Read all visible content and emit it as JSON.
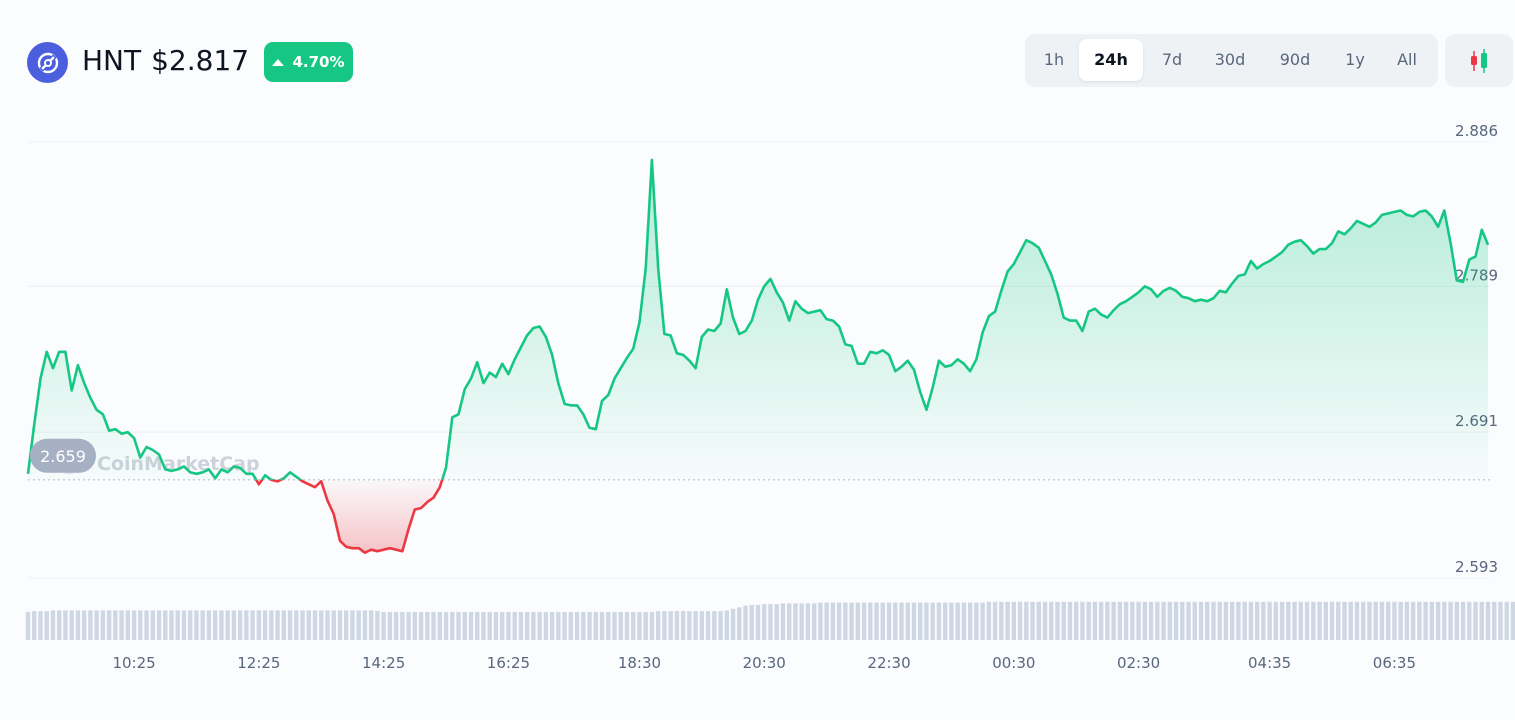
{
  "header": {
    "symbol": "HNT",
    "price": "$2.817",
    "change": "4.70%",
    "change_direction": "up",
    "logo_icon": "helium-logo-icon"
  },
  "ranges": {
    "options": [
      "1h",
      "24h",
      "7d",
      "30d",
      "90d",
      "1y",
      "All"
    ],
    "selected": "24h",
    "candle_icon": "candlestick-icon"
  },
  "watermark": "CoinMarketCap",
  "colors": {
    "up": "#16c784",
    "down": "#ea3943",
    "brand": "#4b5fde"
  },
  "chart_data": {
    "type": "area",
    "title": "",
    "reference_value": 2.659,
    "reference_label": "2.659",
    "y_ticks": [
      2.886,
      2.789,
      2.691,
      2.593
    ],
    "y_tick_labels": [
      "2.886",
      "2.789",
      "2.691",
      "2.593"
    ],
    "ylim": [
      2.593,
      2.886
    ],
    "x_ticks": [
      "10:25",
      "12:25",
      "14:25",
      "16:25",
      "18:30",
      "20:30",
      "22:30",
      "00:30",
      "02:30",
      "04:35",
      "06:35"
    ],
    "x_tick_index": [
      17,
      37,
      57,
      77,
      98,
      118,
      138,
      158,
      178,
      199,
      219
    ],
    "grid": true,
    "series": [
      {
        "values": [
          2.663,
          2.696,
          2.727,
          2.745,
          2.734,
          2.745,
          2.745,
          2.719,
          2.736,
          2.724,
          2.714,
          2.706,
          2.703,
          2.692,
          2.693,
          2.69,
          2.691,
          2.687,
          2.674,
          2.681,
          2.679,
          2.676,
          2.666,
          2.665,
          2.666,
          2.668,
          2.664,
          2.663,
          2.664,
          2.666,
          2.66,
          2.666,
          2.664,
          2.668,
          2.667,
          2.663,
          2.663,
          2.656,
          2.662,
          2.659,
          2.658,
          2.66,
          2.664,
          2.661,
          2.658,
          2.656,
          2.654,
          2.658,
          2.645,
          2.636,
          2.618,
          2.614,
          2.613,
          2.613,
          2.61,
          2.612,
          2.611,
          2.612,
          2.613,
          2.612,
          2.611,
          2.626,
          2.639,
          2.64,
          2.644,
          2.647,
          2.654,
          2.667,
          2.701,
          2.703,
          2.72,
          2.727,
          2.738,
          2.724,
          2.731,
          2.728,
          2.737,
          2.73,
          2.74,
          2.748,
          2.756,
          2.761,
          2.762,
          2.755,
          2.743,
          2.724,
          2.71,
          2.709,
          2.709,
          2.703,
          2.694,
          2.693,
          2.712,
          2.716,
          2.727,
          2.734,
          2.741,
          2.747,
          2.765,
          2.801,
          2.874,
          2.801,
          2.757,
          2.756,
          2.744,
          2.743,
          2.739,
          2.734,
          2.755,
          2.76,
          2.759,
          2.764,
          2.787,
          2.768,
          2.757,
          2.759,
          2.766,
          2.78,
          2.789,
          2.794,
          2.785,
          2.778,
          2.766,
          2.779,
          2.774,
          2.771,
          2.772,
          2.773,
          2.767,
          2.766,
          2.762,
          2.75,
          2.749,
          2.737,
          2.737,
          2.745,
          2.744,
          2.746,
          2.743,
          2.732,
          2.735,
          2.739,
          2.733,
          2.718,
          2.706,
          2.721,
          2.739,
          2.735,
          2.736,
          2.74,
          2.737,
          2.732,
          2.74,
          2.758,
          2.769,
          2.772,
          2.786,
          2.799,
          2.804,
          2.812,
          2.82,
          2.818,
          2.815,
          2.806,
          2.797,
          2.784,
          2.768,
          2.766,
          2.766,
          2.759,
          2.772,
          2.774,
          2.77,
          2.768,
          2.773,
          2.777,
          2.779,
          2.782,
          2.785,
          2.789,
          2.787,
          2.782,
          2.786,
          2.788,
          2.786,
          2.782,
          2.781,
          2.779,
          2.78,
          2.779,
          2.781,
          2.786,
          2.785,
          2.791,
          2.796,
          2.797,
          2.806,
          2.801,
          2.804,
          2.806,
          2.809,
          2.812,
          2.817,
          2.819,
          2.82,
          2.816,
          2.811,
          2.814,
          2.814,
          2.818,
          2.826,
          2.824,
          2.828,
          2.833,
          2.831,
          2.829,
          2.832,
          2.837,
          2.838,
          2.839,
          2.84,
          2.837,
          2.836,
          2.839,
          2.84,
          2.836,
          2.829,
          2.84,
          2.818,
          2.793,
          2.792,
          2.807,
          2.809,
          2.827,
          2.817
        ]
      }
    ],
    "volume_relative": [
      0.36,
      0.37,
      0.37,
      0.37,
      0.38,
      0.38,
      0.38,
      0.38,
      0.38,
      0.38,
      0.38,
      0.38,
      0.38,
      0.38,
      0.38,
      0.38,
      0.38,
      0.38,
      0.38,
      0.38,
      0.38,
      0.38,
      0.38,
      0.38,
      0.38,
      0.38,
      0.38,
      0.38,
      0.38,
      0.38,
      0.38,
      0.38,
      0.38,
      0.38,
      0.38,
      0.38,
      0.38,
      0.38,
      0.38,
      0.38,
      0.38,
      0.38,
      0.38,
      0.38,
      0.38,
      0.38,
      0.38,
      0.38,
      0.38,
      0.38,
      0.38,
      0.38,
      0.38,
      0.38,
      0.38,
      0.38,
      0.37,
      0.36,
      0.36,
      0.36,
      0.36,
      0.36,
      0.36,
      0.36,
      0.36,
      0.36,
      0.36,
      0.36,
      0.36,
      0.36,
      0.36,
      0.36,
      0.36,
      0.36,
      0.36,
      0.36,
      0.36,
      0.36,
      0.36,
      0.36,
      0.36,
      0.36,
      0.36,
      0.36,
      0.36,
      0.36,
      0.36,
      0.36,
      0.36,
      0.36,
      0.36,
      0.36,
      0.36,
      0.36,
      0.36,
      0.36,
      0.36,
      0.36,
      0.36,
      0.36,
      0.36,
      0.37,
      0.37,
      0.37,
      0.37,
      0.37,
      0.37,
      0.37,
      0.37,
      0.37,
      0.37,
      0.37,
      0.38,
      0.4,
      0.42,
      0.44,
      0.45,
      0.45,
      0.46,
      0.46,
      0.46,
      0.47,
      0.47,
      0.47,
      0.47,
      0.47,
      0.47,
      0.48,
      0.48,
      0.48,
      0.48,
      0.48,
      0.48,
      0.48,
      0.48,
      0.48,
      0.48,
      0.48,
      0.48,
      0.48,
      0.48,
      0.48,
      0.48,
      0.48,
      0.48,
      0.48,
      0.48,
      0.48,
      0.48,
      0.48,
      0.48,
      0.48,
      0.48,
      0.48,
      0.49,
      0.49,
      0.49,
      0.49,
      0.49,
      0.49,
      0.49,
      0.49,
      0.49,
      0.49,
      0.49,
      0.49,
      0.49,
      0.49,
      0.49,
      0.49,
      0.49,
      0.49,
      0.49,
      0.49,
      0.49,
      0.49,
      0.49,
      0.49,
      0.49,
      0.49,
      0.49,
      0.49,
      0.49,
      0.49,
      0.49,
      0.49,
      0.49,
      0.49,
      0.49,
      0.49,
      0.49,
      0.49,
      0.49,
      0.49,
      0.49,
      0.49,
      0.49,
      0.49,
      0.49,
      0.49,
      0.49,
      0.49,
      0.49,
      0.49,
      0.49,
      0.49,
      0.49,
      0.49,
      0.49,
      0.49,
      0.49,
      0.49,
      0.49,
      0.49,
      0.49,
      0.49,
      0.49,
      0.49,
      0.49,
      0.49,
      0.49,
      0.49,
      0.49,
      0.49,
      0.49,
      0.49,
      0.49,
      0.49,
      0.49,
      0.49,
      0.49,
      0.49,
      0.49,
      0.49,
      0.49,
      0.49,
      0.49,
      0.49,
      0.49,
      0.49,
      0.49
    ]
  }
}
